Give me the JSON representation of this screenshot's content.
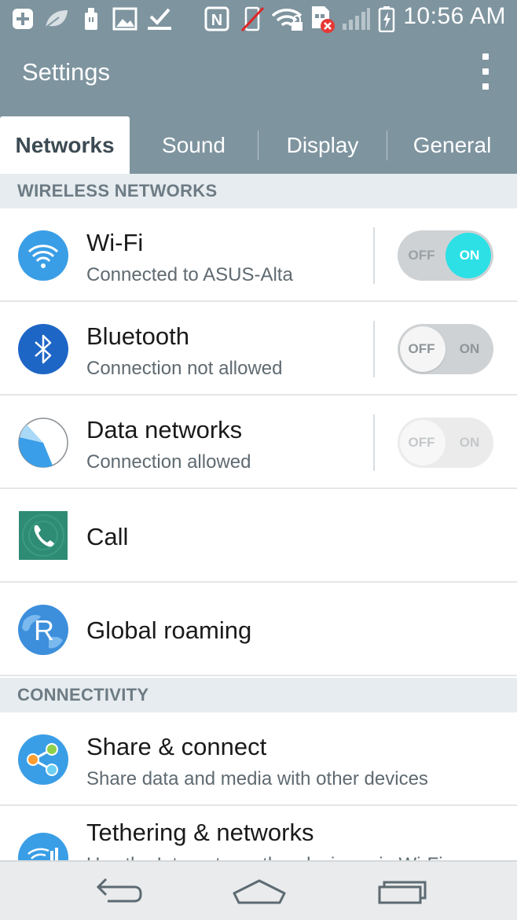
{
  "status_bar": {
    "time": "10:56 AM",
    "icons": [
      "add-notification-icon",
      "leaf-icon",
      "usb-icon",
      "gallery-icon",
      "download-done-icon",
      "nfc-icon",
      "vibrate-off-icon",
      "wifi-lock-icon",
      "sim-error-icon",
      "signal-icon",
      "battery-charging-icon"
    ]
  },
  "action_bar": {
    "title": "Settings",
    "overflow_icon": "more-vert-icon"
  },
  "tabs": [
    {
      "label": "Networks",
      "active": true
    },
    {
      "label": "Sound",
      "active": false
    },
    {
      "label": "Display",
      "active": false
    },
    {
      "label": "General",
      "active": false
    }
  ],
  "sections": {
    "wireless": "WIRELESS NETWORKS",
    "connectivity": "CONNECTIVITY"
  },
  "rows": {
    "wifi": {
      "title": "Wi-Fi",
      "subtitle": "Connected to ASUS-Alta",
      "toggle_state": "on",
      "icon": "wifi-icon"
    },
    "bluetooth": {
      "title": "Bluetooth",
      "subtitle": "Connection not allowed",
      "toggle_state": "off",
      "icon": "bluetooth-icon"
    },
    "data": {
      "title": "Data networks",
      "subtitle": "Connection allowed",
      "toggle_state": "disabled",
      "icon": "data-pie-icon"
    },
    "call": {
      "title": "Call",
      "icon": "phone-icon"
    },
    "roaming": {
      "title": "Global roaming",
      "icon": "globe-roaming-icon"
    },
    "share": {
      "title": "Share & connect",
      "subtitle": "Share data and media with other devices",
      "icon": "share-icon"
    },
    "tethering": {
      "title": "Tethering & networks",
      "subtitle": "Use the Internet on other devices via Wi-Fi",
      "icon": "tethering-icon"
    }
  },
  "toggle_labels": {
    "off": "OFF",
    "on": "ON"
  },
  "nav_bar": {
    "back": "back-icon",
    "home": "home-icon",
    "recents": "recents-icon"
  },
  "colors": {
    "header": "#7e949f",
    "toggle_on": "#2de0e6",
    "section_bg": "#e6ecef"
  }
}
